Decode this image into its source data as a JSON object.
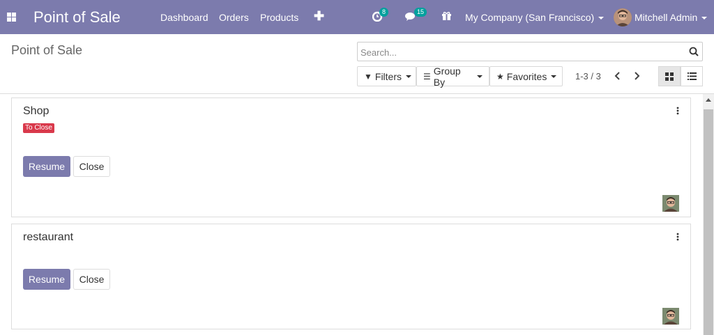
{
  "nav": {
    "brand": "Point of Sale",
    "menu": [
      "Dashboard",
      "Orders",
      "Products"
    ],
    "activity_count": "8",
    "messages_count": "15",
    "company": "My Company (San Francisco)",
    "user": "Mitchell Admin"
  },
  "control_panel": {
    "title": "Point of Sale",
    "search_placeholder": "Search...",
    "filters_label": "Filters",
    "groupby_label": "Group By",
    "favorites_label": "Favorites",
    "pager": "1-3 / 3"
  },
  "cards": [
    {
      "name": "Shop",
      "status": "To Close",
      "resume_label": "Resume",
      "close_label": "Close"
    },
    {
      "name": "restaurant",
      "resume_label": "Resume",
      "close_label": "Close"
    }
  ],
  "colors": {
    "brand": "#7c7bad",
    "badge": "#00a09d",
    "danger": "#d9394b"
  }
}
